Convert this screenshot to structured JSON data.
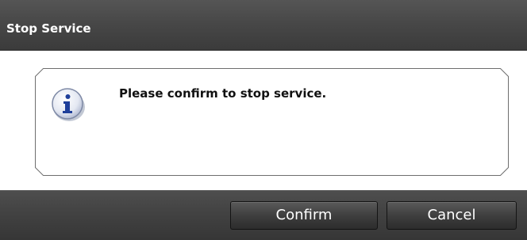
{
  "dialog": {
    "title": "Stop Service",
    "message": "Please confirm to stop service.",
    "icon": "info-icon",
    "buttons": {
      "confirm_label": "Confirm",
      "cancel_label": "Cancel"
    }
  },
  "colors": {
    "titlebar": "#474747",
    "footer": "#414141",
    "icon_accent": "#1f3f9a"
  }
}
